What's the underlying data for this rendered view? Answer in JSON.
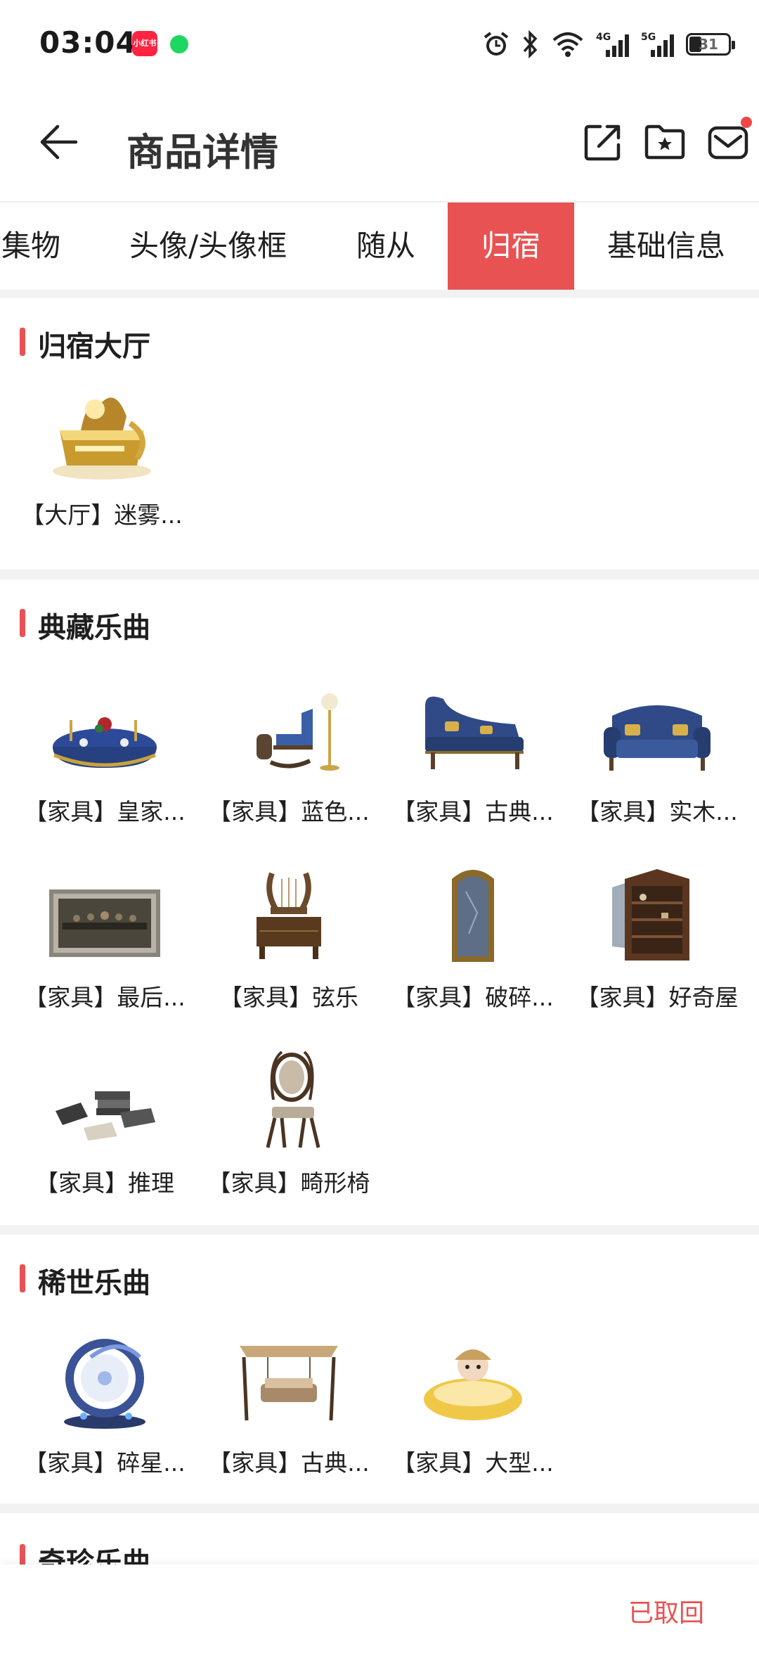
{
  "status_bar": {
    "time": "03:04",
    "app1_label": "小红书",
    "battery": "31",
    "net1": "4G",
    "net2": "5G"
  },
  "header": {
    "title": "商品详情"
  },
  "tabs": [
    {
      "label": "收集物"
    },
    {
      "label": "头像/头像框"
    },
    {
      "label": "随从"
    },
    {
      "label": "归宿",
      "active": true
    },
    {
      "label": "基础信息"
    }
  ],
  "sections": {
    "hall": {
      "title": "归宿大厅",
      "items": [
        {
          "label": "【大厅】迷雾...",
          "icon": "golden-stage-icon"
        }
      ]
    },
    "collection": {
      "title": "典藏乐曲",
      "items": [
        {
          "label": "【家具】皇家...",
          "icon": "royal-table-icon"
        },
        {
          "label": "【家具】蓝色...",
          "icon": "blue-rocking-chair-icon"
        },
        {
          "label": "【家具】古典...",
          "icon": "classic-chaise-icon"
        },
        {
          "label": "【家具】实木...",
          "icon": "wooden-sofa-icon"
        },
        {
          "label": "【家具】最后...",
          "icon": "painting-icon"
        },
        {
          "label": "【家具】弦乐",
          "icon": "lyre-dresser-icon"
        },
        {
          "label": "【家具】破碎...",
          "icon": "broken-mirror-icon"
        },
        {
          "label": "【家具】好奇屋",
          "icon": "curio-cabinet-icon"
        },
        {
          "label": "【家具】推理",
          "icon": "books-icon"
        },
        {
          "label": "【家具】畸形椅",
          "icon": "twisted-chair-icon"
        }
      ]
    },
    "rare": {
      "title": "稀世乐曲",
      "items": [
        {
          "label": "【家具】碎星...",
          "icon": "star-moon-ornament-icon"
        },
        {
          "label": "【家具】古典...",
          "icon": "swing-bench-icon"
        },
        {
          "label": "【家具】大型...",
          "icon": "bathtub-icon"
        }
      ]
    },
    "treasure": {
      "title": "奇珍乐曲"
    }
  },
  "bottom": {
    "status": "已取回"
  },
  "colors": {
    "accent": "#e85252",
    "badge": "#f04646"
  }
}
